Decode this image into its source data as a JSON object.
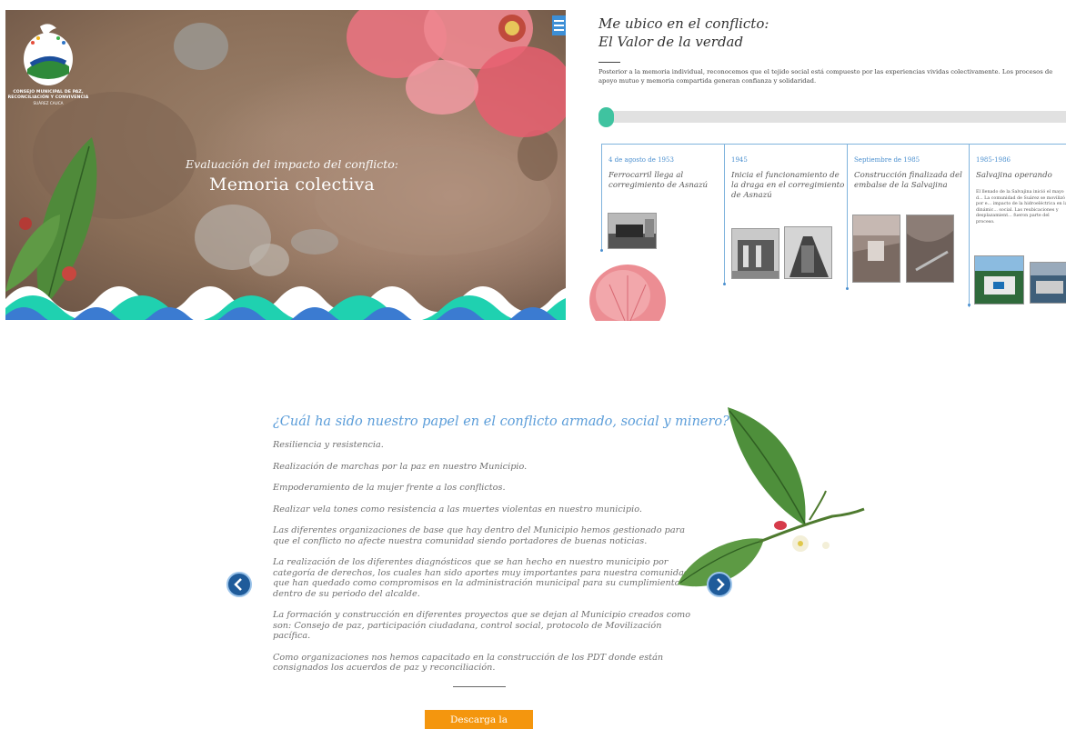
{
  "hero": {
    "org_name_lines": [
      "CONSEJO MUNICIPAL DE PAZ,",
      "RECONCILIACIÓN Y CONVIVENCIA"
    ],
    "org_location": "SUÁREZ CAUCA",
    "subtitle": "Evaluación del impacto del conflicto:",
    "title": "Memoria colectiva",
    "menu_icon": "hamburger-icon"
  },
  "timeline": {
    "title_line1": "Me ubico en el conflicto:",
    "title_line2": "El Valor de la verdad",
    "intro": "Posterior a la memoria individual, reconocemos que el tejido social está compuesto por las experiencias vividas colectivamente. Los procesos de apoyo mutuo y memoria compartida generan confianza y solidaridad.",
    "events": [
      {
        "date": "4 de agosto de 1953",
        "text": "Ferrocarril llega al corregimiento de Asnazú"
      },
      {
        "date": "1945",
        "text": "Inicia el funcionamiento de la draga en el corregimiento de Asnazú"
      },
      {
        "date": "Septiembre de 1985",
        "text": "Construcción finalizada del embalse de la Salvajina"
      },
      {
        "date": "1985-1986",
        "text": "Salvajina operando",
        "desc": "El llenado de la Salvajina inició el mayo d... La comunidad de Suárez se movilizó por e... impacto de la hidroeléctrica en la dinámic... social. Las reubicaciones y desplazamient... fueron parte del proceso."
      }
    ]
  },
  "role": {
    "question": "¿Cuál ha sido nuestro papel en el conflicto armado, social y minero?",
    "items": [
      "Resiliencia y resistencia.",
      "Realización de marchas por la paz en nuestro Municipio.",
      "Empoderamiento de la mujer frente a los conflictos.",
      "Realizar vela tones como resistencia a las muertes violentas en nuestro municipio.",
      "Las diferentes organizaciones de base que hay dentro del Municipio hemos gestionado para que el conflicto no afecte nuestra comunidad siendo portadores de buenas noticias.",
      "La realización de los diferentes diagnósticos que se han hecho en nuestro municipio por categoría de derechos, los cuales han sido aportes muy importantes para nuestra comunidad, que han quedado como compromisos en la administración municipal para su cumplimiento dentro de su periodo del alcalde.",
      "La formación y construcción en diferentes proyectos que se dejan al Municipio creados como son: Consejo de paz, participación ciudadana, control social, protocolo de Movilización pacífica.",
      "Como organizaciones nos hemos capacitado en la construcción de los PDT donde están consignados los acuerdos de paz y reconciliación."
    ],
    "download_label": "Descarga la bitácora",
    "prev_icon": "chevron-left-icon",
    "next_icon": "chevron-right-icon"
  },
  "colors": {
    "accent_blue": "#5b9dd9",
    "teal": "#3fc3a0",
    "download_orange": "#f4960e",
    "nav_blue": "#1f5b9a"
  }
}
